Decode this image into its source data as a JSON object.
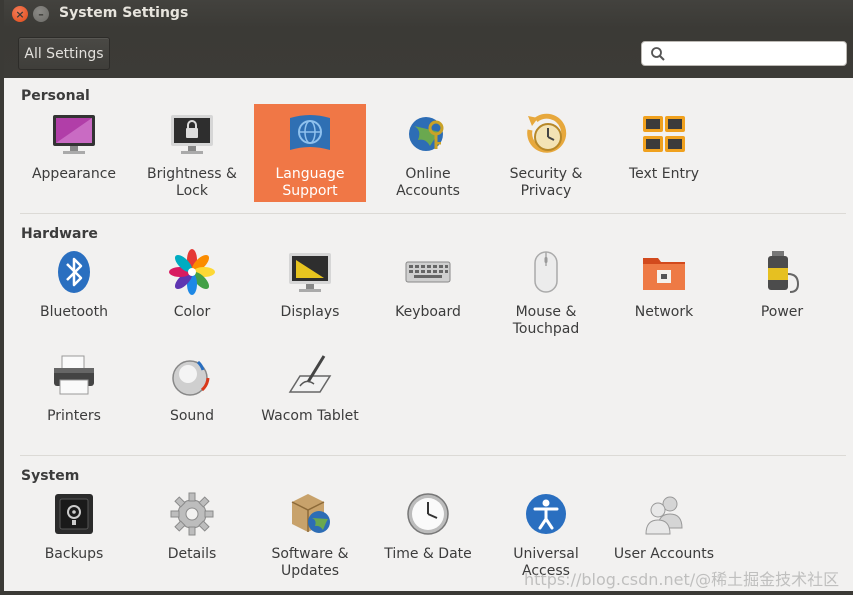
{
  "window": {
    "title": "System Settings"
  },
  "toolbar": {
    "all_settings_label": "All Settings",
    "search_placeholder": ""
  },
  "sections": {
    "personal": {
      "title": "Personal",
      "items": [
        {
          "label": "Appearance",
          "icon": "appearance-icon"
        },
        {
          "label": "Brightness & Lock",
          "icon": "brightness-lock-icon"
        },
        {
          "label": "Language Support",
          "icon": "language-support-icon",
          "selected": true
        },
        {
          "label": "Online Accounts",
          "icon": "online-accounts-icon"
        },
        {
          "label": "Security & Privacy",
          "icon": "security-privacy-icon"
        },
        {
          "label": "Text Entry",
          "icon": "text-entry-icon"
        }
      ]
    },
    "hardware": {
      "title": "Hardware",
      "items": [
        {
          "label": "Bluetooth",
          "icon": "bluetooth-icon"
        },
        {
          "label": "Color",
          "icon": "color-icon"
        },
        {
          "label": "Displays",
          "icon": "displays-icon"
        },
        {
          "label": "Keyboard",
          "icon": "keyboard-icon"
        },
        {
          "label": "Mouse & Touchpad",
          "icon": "mouse-touchpad-icon"
        },
        {
          "label": "Network",
          "icon": "network-icon"
        },
        {
          "label": "Power",
          "icon": "power-icon"
        },
        {
          "label": "Printers",
          "icon": "printers-icon"
        },
        {
          "label": "Sound",
          "icon": "sound-icon"
        },
        {
          "label": "Wacom Tablet",
          "icon": "wacom-tablet-icon"
        }
      ]
    },
    "system": {
      "title": "System",
      "items": [
        {
          "label": "Backups",
          "icon": "backups-icon"
        },
        {
          "label": "Details",
          "icon": "details-icon"
        },
        {
          "label": "Software & Updates",
          "icon": "software-updates-icon"
        },
        {
          "label": "Time & Date",
          "icon": "time-date-icon"
        },
        {
          "label": "Universal Access",
          "icon": "universal-access-icon"
        },
        {
          "label": "User Accounts",
          "icon": "user-accounts-icon"
        }
      ]
    }
  },
  "colors": {
    "selected": "#f07746",
    "titlebar": "#3c3b37"
  },
  "watermark": "https://blog.csdn.net/@稀土掘金技术社区"
}
